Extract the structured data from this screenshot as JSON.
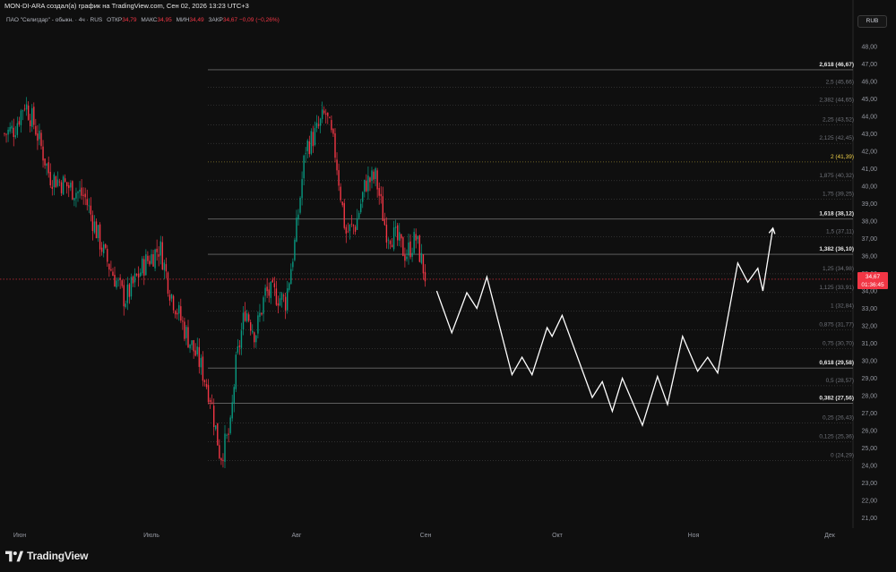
{
  "header": {
    "caption": "MON-DI-ARA создал(а) график на TradingView.com, Сен 02, 2026 13:23 UTC+3",
    "symbol": "ПАО \"Селигдар\" - обыкн. · 4ч · RUS",
    "ohlc": [
      {
        "label": "ОТКР",
        "value": "34,79"
      },
      {
        "label": "МАКС",
        "value": "34,95"
      },
      {
        "label": "МИН",
        "value": "34,49"
      },
      {
        "label": "ЗАКР",
        "value": "34,67"
      }
    ],
    "change": "−0,09 (−0,26%)"
  },
  "currency_button": "RUB",
  "price_badge": {
    "price": "34,67",
    "timer": "01:36:45"
  },
  "logo_text": "TradingView",
  "colors": {
    "background": "#0f0f0f",
    "up": "#089981",
    "down": "#f23645",
    "projection": "#ffffff",
    "fib_highlight": "#f2d24a",
    "text": "#d1d4dc"
  },
  "chart_data": {
    "type": "candlestick",
    "timeframe": "4h",
    "yaxis_ticks": [
      "48,00",
      "47,00",
      "46,00",
      "45,00",
      "44,00",
      "43,00",
      "42,00",
      "41,00",
      "40,00",
      "39,00",
      "38,00",
      "37,00",
      "36,00",
      "35,00",
      "34,00",
      "33,00",
      "32,00",
      "31,00",
      "30,00",
      "29,00",
      "28,00",
      "27,00",
      "26,00",
      "25,00",
      "24,00",
      "23,00",
      "22,00",
      "21,00"
    ],
    "ylim": [
      20.3,
      48.6
    ],
    "xaxis_ticks": [
      "Июн",
      "Июль",
      "Авг",
      "Сен",
      "Окт",
      "Ноя",
      "Дек"
    ],
    "last_price": 34.67,
    "price_path": [
      {
        "x": 0,
        "y": 43.0
      },
      {
        "x": 2,
        "y": 43.3
      },
      {
        "x": 4,
        "y": 44.8
      },
      {
        "x": 6,
        "y": 43.5
      },
      {
        "x": 9,
        "y": 40.6
      },
      {
        "x": 12,
        "y": 40.1
      },
      {
        "x": 16,
        "y": 39.4
      },
      {
        "x": 20,
        "y": 36.0
      },
      {
        "x": 24,
        "y": 33.5
      },
      {
        "x": 28,
        "y": 35.6
      },
      {
        "x": 31,
        "y": 36.5
      },
      {
        "x": 33,
        "y": 34.0
      },
      {
        "x": 36,
        "y": 31.7
      },
      {
        "x": 39,
        "y": 29.8
      },
      {
        "x": 41,
        "y": 28.0
      },
      {
        "x": 43,
        "y": 24.5
      },
      {
        "x": 45,
        "y": 26.0
      },
      {
        "x": 46,
        "y": 29.5
      },
      {
        "x": 48,
        "y": 33.0
      },
      {
        "x": 50,
        "y": 31.5
      },
      {
        "x": 52,
        "y": 33.9
      },
      {
        "x": 54,
        "y": 33.8
      },
      {
        "x": 56,
        "y": 33.4
      },
      {
        "x": 58,
        "y": 37.0
      },
      {
        "x": 60,
        "y": 42.2
      },
      {
        "x": 62,
        "y": 43.0
      },
      {
        "x": 64,
        "y": 44.2
      },
      {
        "x": 66,
        "y": 41.8
      },
      {
        "x": 68,
        "y": 37.3
      },
      {
        "x": 70,
        "y": 37.8
      },
      {
        "x": 72,
        "y": 40.2
      },
      {
        "x": 74,
        "y": 40.5
      },
      {
        "x": 76,
        "y": 37.5
      },
      {
        "x": 78,
        "y": 37.0
      },
      {
        "x": 80,
        "y": 36.1
      },
      {
        "x": 82,
        "y": 37.0
      },
      {
        "x": 84,
        "y": 34.67
      }
    ],
    "fib_levels": [
      {
        "ratio": "0",
        "value": "24,29",
        "bold": false
      },
      {
        "ratio": "0,125",
        "value": "25,36",
        "bold": false
      },
      {
        "ratio": "0,25",
        "value": "26,43",
        "bold": false
      },
      {
        "ratio": "0,382",
        "value": "27,56",
        "bold": true
      },
      {
        "ratio": "0,5",
        "value": "28,57",
        "bold": false
      },
      {
        "ratio": "0,618",
        "value": "29,58",
        "bold": true
      },
      {
        "ratio": "0,75",
        "value": "30,70",
        "bold": false
      },
      {
        "ratio": "0,875",
        "value": "31,77",
        "bold": false
      },
      {
        "ratio": "1",
        "value": "32,84",
        "bold": false
      },
      {
        "ratio": "1,125",
        "value": "33,91",
        "bold": false
      },
      {
        "ratio": "1,25",
        "value": "34,98",
        "bold": false
      },
      {
        "ratio": "1,382",
        "value": "36,10",
        "bold": true
      },
      {
        "ratio": "1,5",
        "value": "37,11",
        "bold": false
      },
      {
        "ratio": "1,618",
        "value": "38,12",
        "bold": true
      },
      {
        "ratio": "1,75",
        "value": "39,25",
        "bold": false
      },
      {
        "ratio": "1,875",
        "value": "40,32",
        "bold": false
      },
      {
        "ratio": "2",
        "value": "41,39",
        "bold": false,
        "highlight": true
      },
      {
        "ratio": "2,125",
        "value": "42,45",
        "bold": false
      },
      {
        "ratio": "2,25",
        "value": "43,52",
        "bold": false
      },
      {
        "ratio": "2,382",
        "value": "44,65",
        "bold": false
      },
      {
        "ratio": "2,5",
        "value": "45,66",
        "bold": false
      },
      {
        "ratio": "2,618",
        "value": "46,67",
        "bold": true
      }
    ],
    "projection_path": [
      {
        "x": 84,
        "y": 34.0
      },
      {
        "x": 87,
        "y": 31.6
      },
      {
        "x": 90,
        "y": 33.9
      },
      {
        "x": 92,
        "y": 33.0
      },
      {
        "x": 94,
        "y": 34.8
      },
      {
        "x": 99,
        "y": 29.2
      },
      {
        "x": 101,
        "y": 30.2
      },
      {
        "x": 103,
        "y": 29.2
      },
      {
        "x": 106,
        "y": 31.9
      },
      {
        "x": 107,
        "y": 31.4
      },
      {
        "x": 109,
        "y": 32.6
      },
      {
        "x": 115,
        "y": 27.9
      },
      {
        "x": 117,
        "y": 28.8
      },
      {
        "x": 119,
        "y": 27.1
      },
      {
        "x": 121,
        "y": 29.0
      },
      {
        "x": 125,
        "y": 26.3
      },
      {
        "x": 128,
        "y": 29.1
      },
      {
        "x": 130,
        "y": 27.5
      },
      {
        "x": 133,
        "y": 31.4
      },
      {
        "x": 136,
        "y": 29.4
      },
      {
        "x": 138,
        "y": 30.2
      },
      {
        "x": 140,
        "y": 29.3
      },
      {
        "x": 144,
        "y": 35.6
      },
      {
        "x": 146,
        "y": 34.5
      },
      {
        "x": 148,
        "y": 35.3
      },
      {
        "x": 149,
        "y": 34.0
      },
      {
        "x": 151,
        "y": 37.6
      }
    ]
  }
}
